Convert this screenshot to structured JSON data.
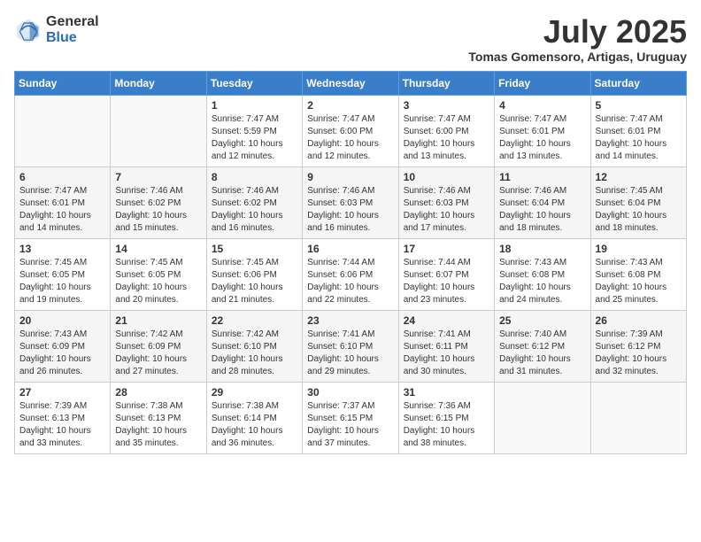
{
  "logo": {
    "general": "General",
    "blue": "Blue"
  },
  "header": {
    "month": "July 2025",
    "location": "Tomas Gomensoro, Artigas, Uruguay"
  },
  "weekdays": [
    "Sunday",
    "Monday",
    "Tuesday",
    "Wednesday",
    "Thursday",
    "Friday",
    "Saturday"
  ],
  "weeks": [
    [
      {
        "day": "",
        "info": ""
      },
      {
        "day": "",
        "info": ""
      },
      {
        "day": "1",
        "info": "Sunrise: 7:47 AM\nSunset: 5:59 PM\nDaylight: 10 hours and 12 minutes."
      },
      {
        "day": "2",
        "info": "Sunrise: 7:47 AM\nSunset: 6:00 PM\nDaylight: 10 hours and 12 minutes."
      },
      {
        "day": "3",
        "info": "Sunrise: 7:47 AM\nSunset: 6:00 PM\nDaylight: 10 hours and 13 minutes."
      },
      {
        "day": "4",
        "info": "Sunrise: 7:47 AM\nSunset: 6:01 PM\nDaylight: 10 hours and 13 minutes."
      },
      {
        "day": "5",
        "info": "Sunrise: 7:47 AM\nSunset: 6:01 PM\nDaylight: 10 hours and 14 minutes."
      }
    ],
    [
      {
        "day": "6",
        "info": "Sunrise: 7:47 AM\nSunset: 6:01 PM\nDaylight: 10 hours and 14 minutes."
      },
      {
        "day": "7",
        "info": "Sunrise: 7:46 AM\nSunset: 6:02 PM\nDaylight: 10 hours and 15 minutes."
      },
      {
        "day": "8",
        "info": "Sunrise: 7:46 AM\nSunset: 6:02 PM\nDaylight: 10 hours and 16 minutes."
      },
      {
        "day": "9",
        "info": "Sunrise: 7:46 AM\nSunset: 6:03 PM\nDaylight: 10 hours and 16 minutes."
      },
      {
        "day": "10",
        "info": "Sunrise: 7:46 AM\nSunset: 6:03 PM\nDaylight: 10 hours and 17 minutes."
      },
      {
        "day": "11",
        "info": "Sunrise: 7:46 AM\nSunset: 6:04 PM\nDaylight: 10 hours and 18 minutes."
      },
      {
        "day": "12",
        "info": "Sunrise: 7:45 AM\nSunset: 6:04 PM\nDaylight: 10 hours and 18 minutes."
      }
    ],
    [
      {
        "day": "13",
        "info": "Sunrise: 7:45 AM\nSunset: 6:05 PM\nDaylight: 10 hours and 19 minutes."
      },
      {
        "day": "14",
        "info": "Sunrise: 7:45 AM\nSunset: 6:05 PM\nDaylight: 10 hours and 20 minutes."
      },
      {
        "day": "15",
        "info": "Sunrise: 7:45 AM\nSunset: 6:06 PM\nDaylight: 10 hours and 21 minutes."
      },
      {
        "day": "16",
        "info": "Sunrise: 7:44 AM\nSunset: 6:06 PM\nDaylight: 10 hours and 22 minutes."
      },
      {
        "day": "17",
        "info": "Sunrise: 7:44 AM\nSunset: 6:07 PM\nDaylight: 10 hours and 23 minutes."
      },
      {
        "day": "18",
        "info": "Sunrise: 7:43 AM\nSunset: 6:08 PM\nDaylight: 10 hours and 24 minutes."
      },
      {
        "day": "19",
        "info": "Sunrise: 7:43 AM\nSunset: 6:08 PM\nDaylight: 10 hours and 25 minutes."
      }
    ],
    [
      {
        "day": "20",
        "info": "Sunrise: 7:43 AM\nSunset: 6:09 PM\nDaylight: 10 hours and 26 minutes."
      },
      {
        "day": "21",
        "info": "Sunrise: 7:42 AM\nSunset: 6:09 PM\nDaylight: 10 hours and 27 minutes."
      },
      {
        "day": "22",
        "info": "Sunrise: 7:42 AM\nSunset: 6:10 PM\nDaylight: 10 hours and 28 minutes."
      },
      {
        "day": "23",
        "info": "Sunrise: 7:41 AM\nSunset: 6:10 PM\nDaylight: 10 hours and 29 minutes."
      },
      {
        "day": "24",
        "info": "Sunrise: 7:41 AM\nSunset: 6:11 PM\nDaylight: 10 hours and 30 minutes."
      },
      {
        "day": "25",
        "info": "Sunrise: 7:40 AM\nSunset: 6:12 PM\nDaylight: 10 hours and 31 minutes."
      },
      {
        "day": "26",
        "info": "Sunrise: 7:39 AM\nSunset: 6:12 PM\nDaylight: 10 hours and 32 minutes."
      }
    ],
    [
      {
        "day": "27",
        "info": "Sunrise: 7:39 AM\nSunset: 6:13 PM\nDaylight: 10 hours and 33 minutes."
      },
      {
        "day": "28",
        "info": "Sunrise: 7:38 AM\nSunset: 6:13 PM\nDaylight: 10 hours and 35 minutes."
      },
      {
        "day": "29",
        "info": "Sunrise: 7:38 AM\nSunset: 6:14 PM\nDaylight: 10 hours and 36 minutes."
      },
      {
        "day": "30",
        "info": "Sunrise: 7:37 AM\nSunset: 6:15 PM\nDaylight: 10 hours and 37 minutes."
      },
      {
        "day": "31",
        "info": "Sunrise: 7:36 AM\nSunset: 6:15 PM\nDaylight: 10 hours and 38 minutes."
      },
      {
        "day": "",
        "info": ""
      },
      {
        "day": "",
        "info": ""
      }
    ]
  ]
}
